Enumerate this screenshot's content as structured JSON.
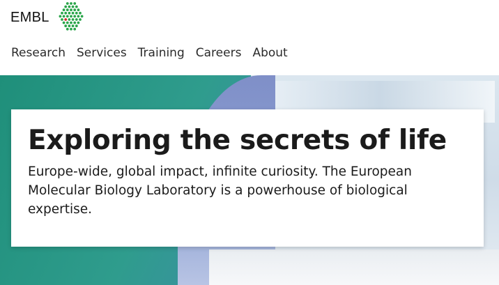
{
  "header": {
    "logo_text": "EMBL",
    "logo_icon": "embl-hexagon-dots-icon",
    "brand_color": "#2aa54a",
    "accent_dot_color": "#d42a2a"
  },
  "nav": {
    "items": [
      {
        "label": "Research"
      },
      {
        "label": "Services"
      },
      {
        "label": "Training"
      },
      {
        "label": "Careers"
      },
      {
        "label": "About"
      }
    ]
  },
  "hero": {
    "title": "Exploring the secrets of life",
    "description": "Europe-wide, global impact, infinite curiosity. The European Molecular Biology Laboratory is a powerhouse of biological expertise."
  }
}
